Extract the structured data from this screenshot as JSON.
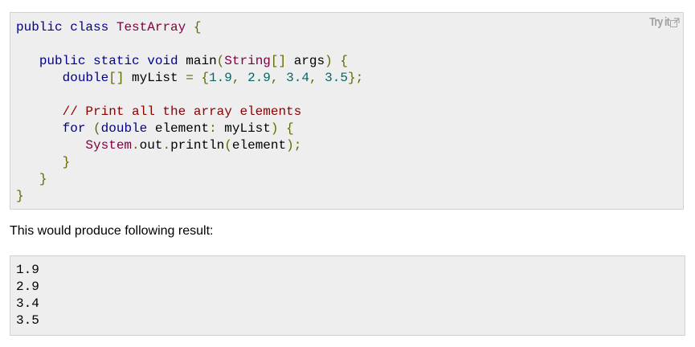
{
  "code_example": {
    "try_it_label": "Try it",
    "try_it_icon": "external-link-icon",
    "lines": [
      [
        {
          "t": "public",
          "c": "kw"
        },
        {
          "t": " ",
          "c": "pln"
        },
        {
          "t": "class",
          "c": "kw"
        },
        {
          "t": " ",
          "c": "pln"
        },
        {
          "t": "TestArray",
          "c": "typ"
        },
        {
          "t": " ",
          "c": "pln"
        },
        {
          "t": "{",
          "c": "pun"
        }
      ],
      [],
      [
        {
          "t": "   ",
          "c": "pln"
        },
        {
          "t": "public",
          "c": "kw"
        },
        {
          "t": " ",
          "c": "pln"
        },
        {
          "t": "static",
          "c": "kw"
        },
        {
          "t": " ",
          "c": "pln"
        },
        {
          "t": "void",
          "c": "kw"
        },
        {
          "t": " main",
          "c": "pln"
        },
        {
          "t": "(",
          "c": "pun"
        },
        {
          "t": "String",
          "c": "typ"
        },
        {
          "t": "[]",
          "c": "pun"
        },
        {
          "t": " args",
          "c": "pln"
        },
        {
          "t": ")",
          "c": "pun"
        },
        {
          "t": " ",
          "c": "pln"
        },
        {
          "t": "{",
          "c": "pun"
        }
      ],
      [
        {
          "t": "      ",
          "c": "pln"
        },
        {
          "t": "double",
          "c": "kw"
        },
        {
          "t": "[]",
          "c": "pun"
        },
        {
          "t": " myList ",
          "c": "pln"
        },
        {
          "t": "=",
          "c": "pun"
        },
        {
          "t": " ",
          "c": "pln"
        },
        {
          "t": "{",
          "c": "pun"
        },
        {
          "t": "1.9",
          "c": "lit"
        },
        {
          "t": ",",
          "c": "pun"
        },
        {
          "t": " ",
          "c": "pln"
        },
        {
          "t": "2.9",
          "c": "lit"
        },
        {
          "t": ",",
          "c": "pun"
        },
        {
          "t": " ",
          "c": "pln"
        },
        {
          "t": "3.4",
          "c": "lit"
        },
        {
          "t": ",",
          "c": "pun"
        },
        {
          "t": " ",
          "c": "pln"
        },
        {
          "t": "3.5",
          "c": "lit"
        },
        {
          "t": "};",
          "c": "pun"
        }
      ],
      [],
      [
        {
          "t": "      ",
          "c": "pln"
        },
        {
          "t": "// Print all the array elements",
          "c": "com"
        }
      ],
      [
        {
          "t": "      ",
          "c": "pln"
        },
        {
          "t": "for",
          "c": "kw"
        },
        {
          "t": " ",
          "c": "pln"
        },
        {
          "t": "(",
          "c": "pun"
        },
        {
          "t": "double",
          "c": "kw"
        },
        {
          "t": " element",
          "c": "pln"
        },
        {
          "t": ":",
          "c": "pun"
        },
        {
          "t": " myList",
          "c": "pln"
        },
        {
          "t": ")",
          "c": "pun"
        },
        {
          "t": " ",
          "c": "pln"
        },
        {
          "t": "{",
          "c": "pun"
        }
      ],
      [
        {
          "t": "         ",
          "c": "pln"
        },
        {
          "t": "System",
          "c": "typ"
        },
        {
          "t": ".",
          "c": "pun"
        },
        {
          "t": "out",
          "c": "pln"
        },
        {
          "t": ".",
          "c": "pun"
        },
        {
          "t": "println",
          "c": "pln"
        },
        {
          "t": "(",
          "c": "pun"
        },
        {
          "t": "element",
          "c": "pln"
        },
        {
          "t": ");",
          "c": "pun"
        }
      ],
      [
        {
          "t": "      ",
          "c": "pln"
        },
        {
          "t": "}",
          "c": "pun"
        }
      ],
      [
        {
          "t": "   ",
          "c": "pln"
        },
        {
          "t": "}",
          "c": "pun"
        }
      ],
      [
        {
          "t": "}",
          "c": "pun"
        }
      ]
    ]
  },
  "result_text": "This would produce following result:",
  "output_lines": [
    "1.9",
    "2.9",
    "3.4",
    "3.5"
  ]
}
